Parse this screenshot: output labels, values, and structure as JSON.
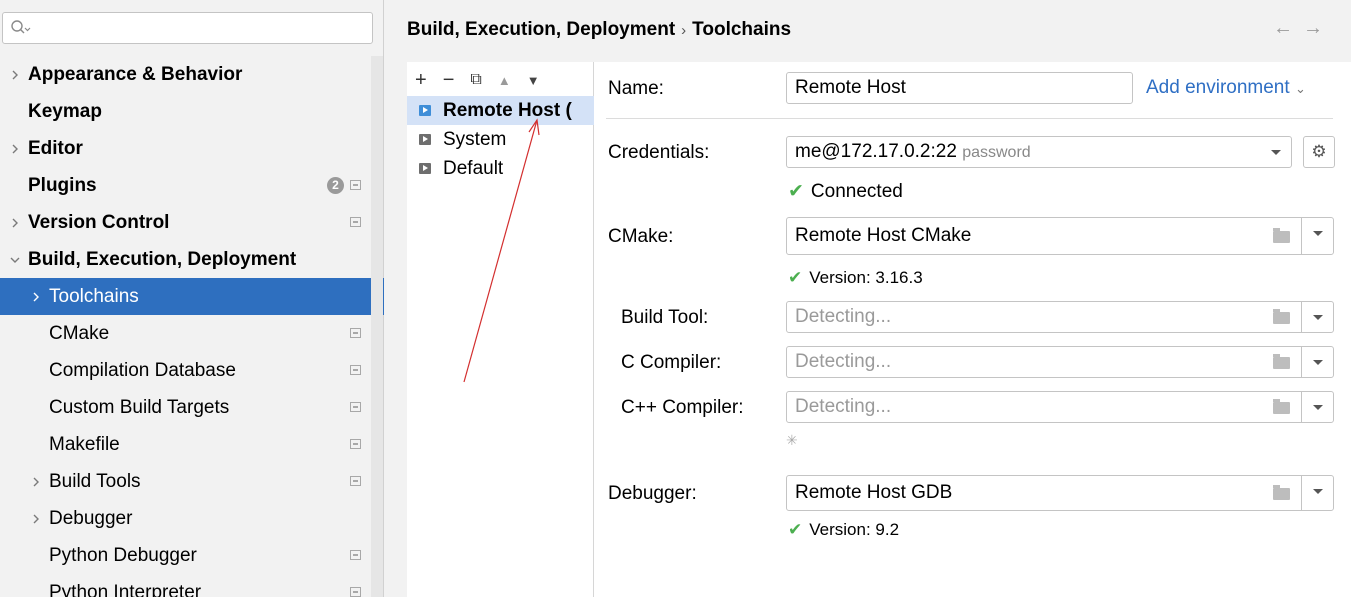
{
  "search": {
    "placeholder": ""
  },
  "sidebar": {
    "items": [
      {
        "label": "Appearance & Behavior",
        "level": 0,
        "bold": true,
        "chevron": "right"
      },
      {
        "label": "Keymap",
        "level": 0,
        "bold": true,
        "chevron": "none"
      },
      {
        "label": "Editor",
        "level": 0,
        "bold": true,
        "chevron": "right"
      },
      {
        "label": "Plugins",
        "level": 0,
        "bold": true,
        "chevron": "none",
        "badge": "2",
        "project_icon": true
      },
      {
        "label": "Version Control",
        "level": 0,
        "bold": true,
        "chevron": "right",
        "project_icon": true
      },
      {
        "label": "Build, Execution, Deployment",
        "level": 0,
        "bold": true,
        "chevron": "down"
      },
      {
        "label": "Toolchains",
        "level": 1,
        "bold": false,
        "chevron": "right",
        "selected": true
      },
      {
        "label": "CMake",
        "level": 1,
        "bold": false,
        "chevron": "none",
        "project_icon": true
      },
      {
        "label": "Compilation Database",
        "level": 1,
        "bold": false,
        "chevron": "none",
        "project_icon": true
      },
      {
        "label": "Custom Build Targets",
        "level": 1,
        "bold": false,
        "chevron": "none",
        "project_icon": true
      },
      {
        "label": "Makefile",
        "level": 1,
        "bold": false,
        "chevron": "none",
        "project_icon": true
      },
      {
        "label": "Build Tools",
        "level": 1,
        "bold": false,
        "chevron": "right",
        "project_icon": true
      },
      {
        "label": "Debugger",
        "level": 1,
        "bold": false,
        "chevron": "right"
      },
      {
        "label": "Python Debugger",
        "level": 1,
        "bold": false,
        "chevron": "none",
        "project_icon": true
      },
      {
        "label": "Python Interpreter",
        "level": 1,
        "bold": false,
        "chevron": "none",
        "project_icon": true
      }
    ]
  },
  "breadcrumb": {
    "parent": "Build, Execution, Deployment",
    "separator": "›",
    "current": "Toolchains"
  },
  "nav": {
    "back": "←",
    "forward": "→"
  },
  "toolchains": {
    "toolbar": {
      "add": "+",
      "remove": "−",
      "copy": "⧉",
      "up": "▲",
      "down": "▼"
    },
    "items": [
      {
        "label": "Remote Host (",
        "selected": true
      },
      {
        "label": "System",
        "selected": false
      },
      {
        "label": "Default",
        "selected": false
      }
    ]
  },
  "form": {
    "name_label": "Name:",
    "name_value": "Remote Host",
    "add_environment": "Add environment",
    "credentials_label": "Credentials:",
    "credentials_value": "me@172.17.0.2:22",
    "credentials_hint": "password",
    "connected_status": "Connected",
    "cmake_label": "CMake:",
    "cmake_value": "Remote Host CMake",
    "cmake_version": "Version: 3.16.3",
    "build_tool_label": "Build Tool:",
    "build_tool_value": "Detecting...",
    "c_compiler_label": "C Compiler:",
    "c_compiler_value": "Detecting...",
    "cpp_compiler_label": "C++ Compiler:",
    "cpp_compiler_value": "Detecting...",
    "debugger_label": "Debugger:",
    "debugger_value": "Remote Host GDB",
    "debugger_version": "Version: 9.2"
  },
  "colors": {
    "selection": "#2e6fbf",
    "link": "#2f6fc4",
    "success": "#4caf50",
    "annotation": "#d32f2f"
  }
}
